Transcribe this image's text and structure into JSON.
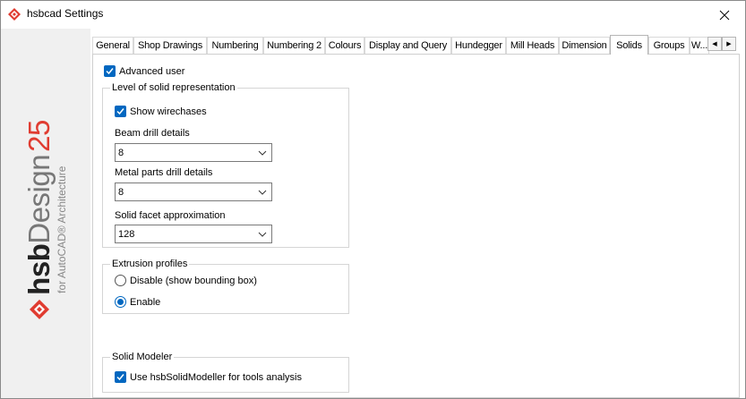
{
  "window": {
    "title": "hsbcad Settings"
  },
  "brand": {
    "hsb": "hsb",
    "design": "Design",
    "version": "25",
    "subtitle": "for AutoCAD® Architecture"
  },
  "tabs": [
    "General",
    "Shop Drawings",
    "Numbering",
    "Numbering 2",
    "Colours",
    "Display and Query",
    "Hundegger",
    "Mill Heads",
    "Dimension",
    "Solids",
    "Groups",
    "W..."
  ],
  "active_tab": "Solids",
  "panel": {
    "advanced_user": {
      "label": "Advanced user",
      "checked": true
    },
    "solid_group": {
      "title": "Level of solid representation",
      "show_wirechases": {
        "label": "Show wirechases",
        "checked": true
      },
      "beam_drill": {
        "label": "Beam drill details",
        "value": "8"
      },
      "metal_drill": {
        "label": "Metal parts drill details",
        "value": "8"
      },
      "facet": {
        "label": "Solid facet approximation",
        "value": "128"
      }
    },
    "extrusion_group": {
      "title": "Extrusion profiles",
      "disable_label": "Disable (show bounding box)",
      "enable_label": "Enable",
      "selected": "Enable"
    },
    "modeler_group": {
      "title": "Solid Modeler",
      "use_modeller": {
        "label": "Use hsbSolidModeller for tools analysis",
        "checked": true
      }
    }
  },
  "colors": {
    "accent": "#0067c0",
    "brand_red": "#e03c31"
  }
}
